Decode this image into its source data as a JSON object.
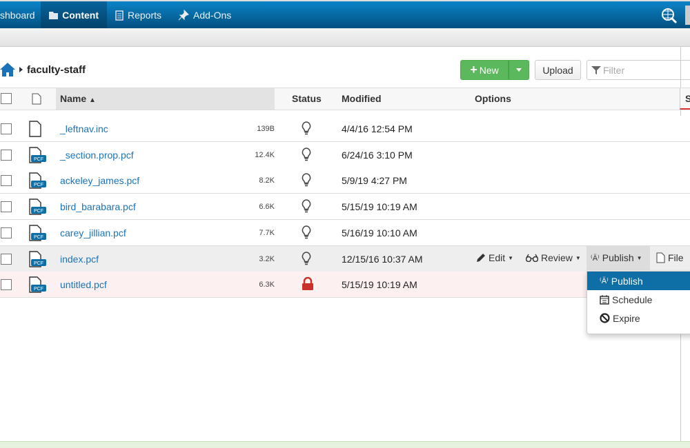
{
  "nav": {
    "items": [
      {
        "label": "shboard"
      },
      {
        "label": "Content"
      },
      {
        "label": "Reports"
      },
      {
        "label": "Add-Ons"
      }
    ]
  },
  "breadcrumb": {
    "folder": "faculty-staff"
  },
  "toolbar": {
    "new_label": "New",
    "upload_label": "Upload",
    "filter_placeholder": "Filter"
  },
  "table": {
    "headers": {
      "name": "Name",
      "status": "Status",
      "modified": "Modified",
      "options": "Options",
      "extra": "S"
    },
    "rows": [
      {
        "name": "_leftnav.inc",
        "size": "139B",
        "modified": "4/4/16 12:54 PM",
        "status": "bulb",
        "pcf": false
      },
      {
        "name": "_section.prop.pcf",
        "size": "12.4K",
        "modified": "6/24/16 3:10 PM",
        "status": "bulb",
        "pcf": true
      },
      {
        "name": "ackeley_james.pcf",
        "size": "8.2K",
        "modified": "5/9/19 4:27 PM",
        "status": "bulb",
        "pcf": true
      },
      {
        "name": "bird_barabara.pcf",
        "size": "6.6K",
        "modified": "5/15/19 10:19 AM",
        "status": "bulb",
        "pcf": true
      },
      {
        "name": "carey_jillian.pcf",
        "size": "7.7K",
        "modified": "5/16/19 10:10 AM",
        "status": "bulb",
        "pcf": true
      },
      {
        "name": "index.pcf",
        "size": "3.2K",
        "modified": "12/15/16 10:37 AM",
        "status": "bulb",
        "pcf": true
      },
      {
        "name": "untitled.pcf",
        "size": "6.3K",
        "modified": "5/15/19 10:19 AM",
        "status": "lock",
        "pcf": true
      }
    ],
    "pcf_badge": "PCF"
  },
  "row_options": {
    "edit": "Edit",
    "review": "Review",
    "publish": "Publish",
    "file": "File"
  },
  "publish_menu": {
    "items": [
      {
        "label": "Publish"
      },
      {
        "label": "Schedule"
      },
      {
        "label": "Expire"
      }
    ]
  },
  "colors": {
    "accent": "#0e6ea6",
    "green": "#5cb85c",
    "lock": "#c9302c",
    "link": "#1a73b8"
  }
}
